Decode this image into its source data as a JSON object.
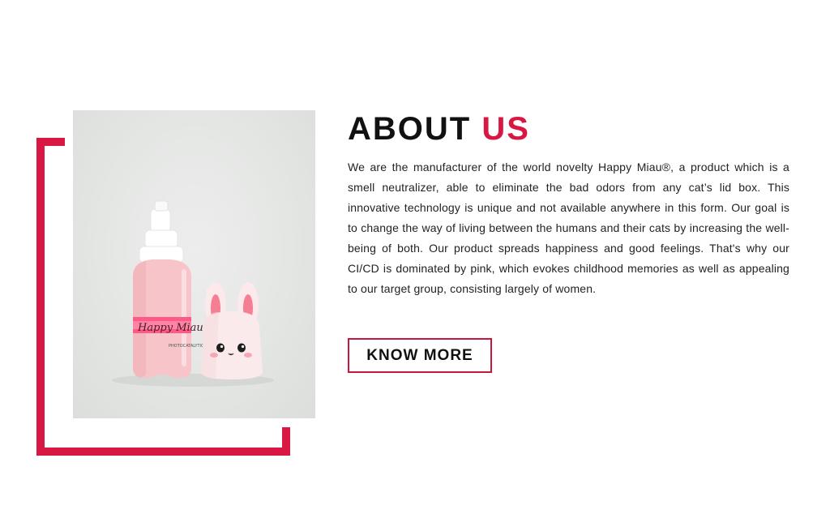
{
  "about": {
    "title_main": "ABOUT",
    "title_accent": "US",
    "body": "We are the manufacturer of the world novelty Happy Miau®, a product which is a smell neutralizer, able to eliminate the bad odors from any cat’s lid box. This innovative technology is unique and not available anywhere in this form. Our goal is to change the way of living between the humans and their cats by increasing the well-being of both. Our product spreads happiness and good feelings. That's why our CI/CD is dominated by pink, which evokes childhood memories as well as appealing to our target group, consisting largely of women.",
    "button_label": "KNOW MORE"
  },
  "product_image": {
    "bottle_label": "Happy Miau",
    "bottle_sublabel": "PHOTOCATALYTIC"
  },
  "colors": {
    "accent": "#d81842",
    "text": "#111111",
    "bottle_pink": "#f6c4c9"
  }
}
